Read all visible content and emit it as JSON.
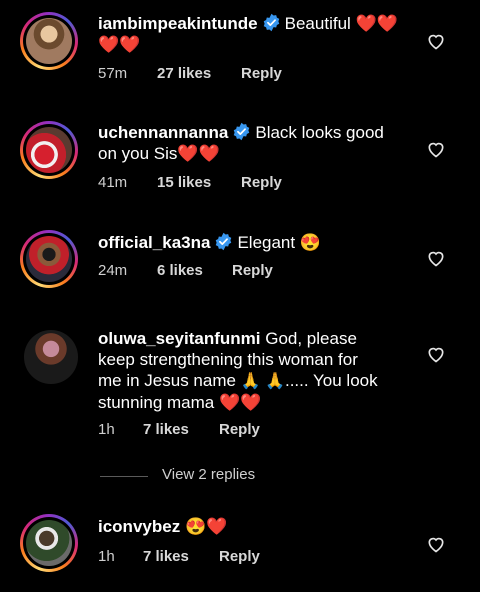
{
  "comments": [
    {
      "username": "iambimpeakintunde",
      "verified": true,
      "text": "Beautiful",
      "emoji_line1": "❤️❤️",
      "emoji_line2": "❤️❤️",
      "time": "57m",
      "likes": "27 likes",
      "reply": "Reply"
    },
    {
      "username": "uchennannanna",
      "verified": true,
      "text_line1": "Black looks good",
      "text_line2": "on you Sis",
      "emoji": "❤️❤️",
      "time": "41m",
      "likes": "15 likes",
      "reply": "Reply"
    },
    {
      "username": "official_ka3na",
      "verified": true,
      "text": "Elegant",
      "emoji": "😍",
      "time": "24m",
      "likes": "6 likes",
      "reply": "Reply"
    },
    {
      "username": "oluwa_seyitanfunmi",
      "verified": false,
      "text_line1": "God, please",
      "text_line2": "keep strengthening this woman for",
      "text_line3a": "me in Jesus name",
      "emoji_pray": "🙏 🙏",
      "text_line3b": "..... You look",
      "text_line4": "stunning mama",
      "emoji": "❤️❤️",
      "time": "1h",
      "likes": "7 likes",
      "reply": "Reply"
    },
    {
      "username": "iconvybez",
      "verified": false,
      "emoji": "😍❤️",
      "time": "1h",
      "likes": "7 likes",
      "reply": "Reply"
    }
  ],
  "view_replies": "View 2 replies",
  "icons": {
    "verified": "verified-badge-icon",
    "like": "heart-outline-icon"
  },
  "colors": {
    "background": "#000000",
    "verified": "#3897f0",
    "heart": "#e0102a"
  }
}
